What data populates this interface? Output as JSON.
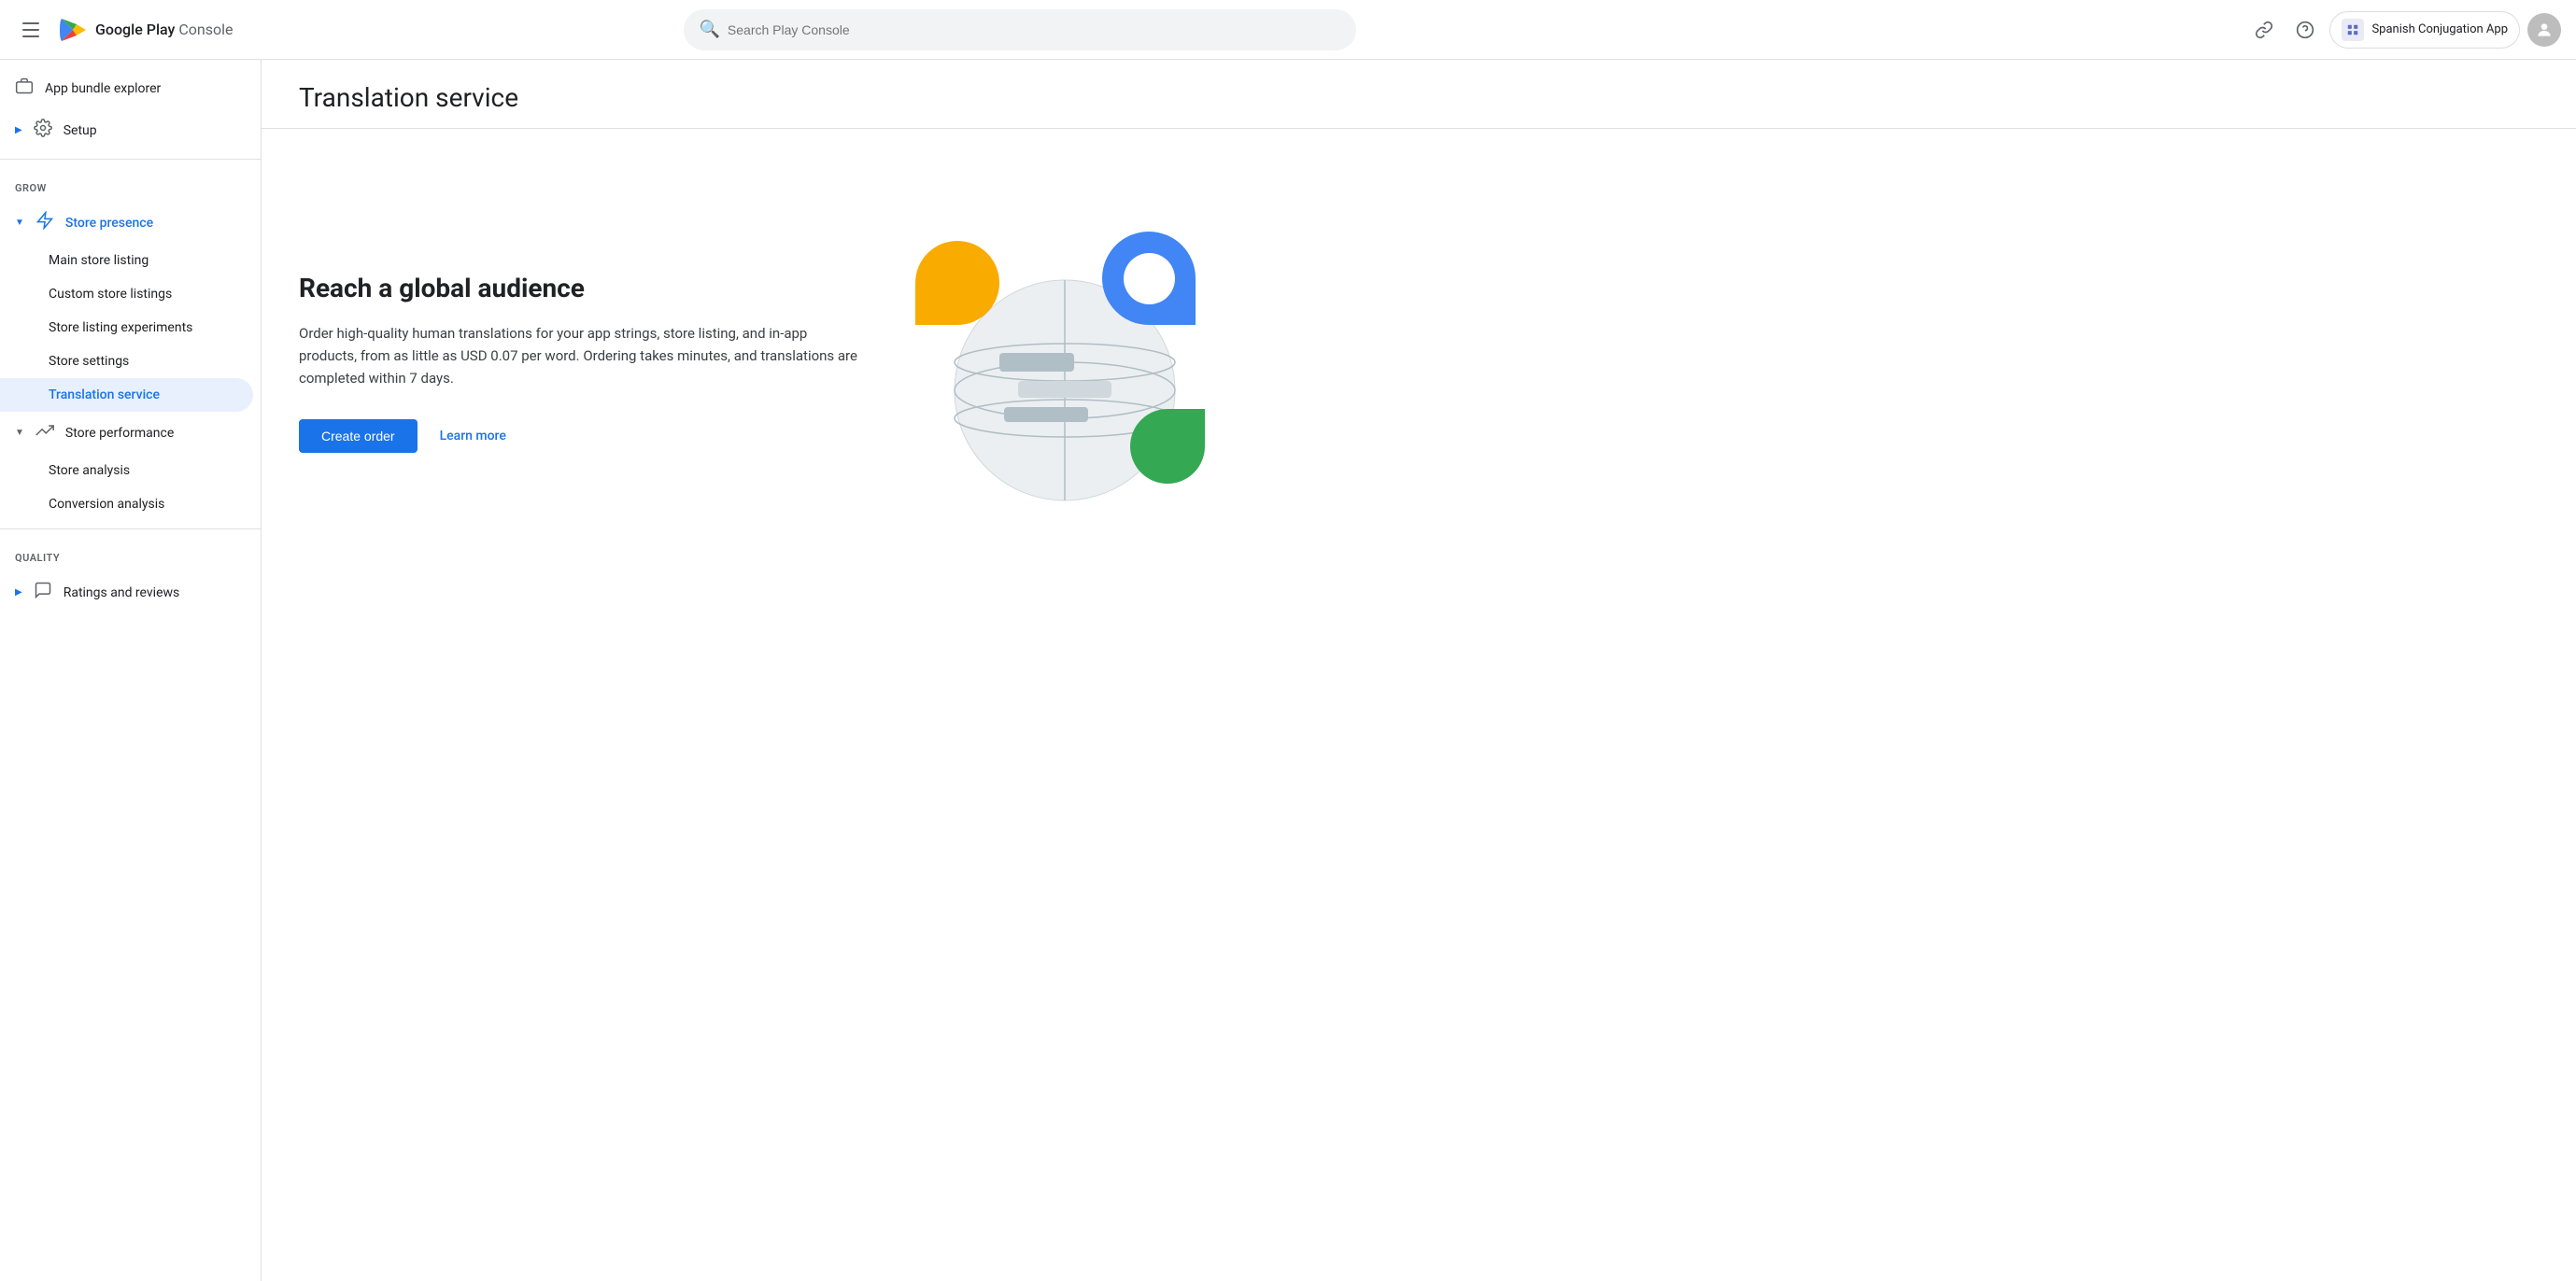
{
  "header": {
    "menu_label": "Menu",
    "logo_brand": "Google Play",
    "logo_suffix": "Console",
    "search_placeholder": "Search Play Console",
    "app_name": "Spanish Conjugation App"
  },
  "sidebar": {
    "top_items": [
      {
        "id": "app-bundle-explorer",
        "label": "App bundle explorer",
        "icon": "bundle"
      },
      {
        "id": "setup",
        "label": "Setup",
        "icon": "settings",
        "expandable": true
      }
    ],
    "sections": [
      {
        "label": "Grow",
        "items": [
          {
            "id": "store-presence",
            "label": "Store presence",
            "icon": "store-presence",
            "expanded": true,
            "active_parent": true,
            "children": [
              {
                "id": "main-store-listing",
                "label": "Main store listing"
              },
              {
                "id": "custom-store-listings",
                "label": "Custom store listings"
              },
              {
                "id": "store-listing-experiments",
                "label": "Store listing experiments"
              },
              {
                "id": "store-settings",
                "label": "Store settings"
              },
              {
                "id": "translation-service",
                "label": "Translation service",
                "active": true
              }
            ]
          },
          {
            "id": "store-performance",
            "label": "Store performance",
            "icon": "trending-up",
            "expanded": true,
            "children": [
              {
                "id": "store-analysis",
                "label": "Store analysis"
              },
              {
                "id": "conversion-analysis",
                "label": "Conversion analysis"
              }
            ]
          }
        ]
      },
      {
        "label": "Quality",
        "items": [
          {
            "id": "ratings-and-reviews",
            "label": "Ratings and reviews",
            "icon": "reviews",
            "expandable": true
          }
        ]
      }
    ]
  },
  "main": {
    "title": "Translation service",
    "reach_heading": "Reach a global audience",
    "reach_description": "Order high-quality human translations for your app strings, store listing, and in-app products, from as little as USD 0.07 per word. Ordering takes minutes, and translations are completed within 7 days.",
    "create_order_label": "Create order",
    "learn_more_label": "Learn more"
  }
}
